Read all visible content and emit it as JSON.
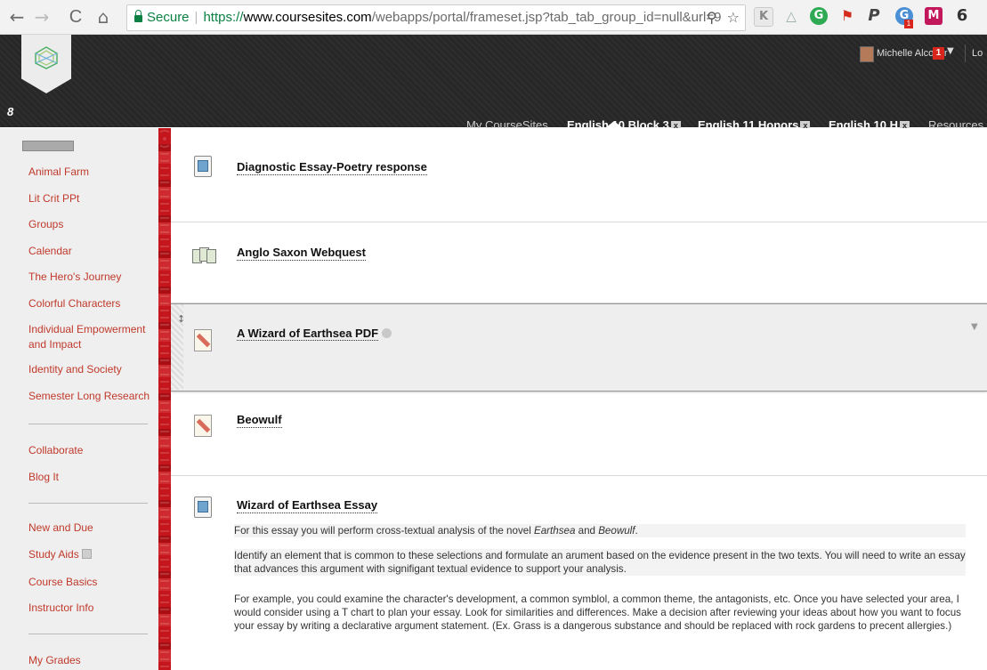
{
  "browser": {
    "back": "←",
    "forward": "→",
    "reload": "C",
    "home": "⌂",
    "secure_label": "Secure",
    "url_proto": "https://",
    "url_host": "www.coursesites.com",
    "url_path": "/webapps/portal/frameset.jsp?tab_tab_group_id=null&url=9",
    "zoom_icon": "zoom-icon",
    "star_icon": "star-icon",
    "extensions": [
      "K",
      "△",
      "G",
      "⚑",
      "P",
      "G",
      "M",
      "6"
    ],
    "ext_badge": "1"
  },
  "header": {
    "user_name": "Michelle Alcoser",
    "notif_count": "1",
    "logout": "Lo",
    "pin": "8",
    "tabs": [
      "My CourseSites",
      "English 10 Block 3",
      "English 11 Honors",
      "English 10 H",
      "Resources"
    ],
    "tab_close": "x"
  },
  "sidebar": {
    "items": [
      "Animal Farm",
      "Lit Crit PPt",
      "Groups",
      "Calendar",
      "The Hero's Journey",
      "Colorful Characters",
      "Individual Empowerment and Impact",
      "Identity and Society",
      "Semester Long Research",
      "Collaborate",
      "Blog It",
      "New and Due",
      "Study Aids",
      "Course Basics",
      "Instructor Info",
      "My Grades"
    ]
  },
  "content": {
    "items": [
      {
        "title": "Diagnostic Essay-Poetry response",
        "icon": "assignment-icon"
      },
      {
        "title": "Anglo Saxon Webquest",
        "icon": "webquest-icon"
      },
      {
        "title": "A Wizard of Earthsea PDF",
        "icon": "file-icon"
      },
      {
        "title": "Beowulf",
        "icon": "file-icon"
      },
      {
        "title": "Wizard of Earthsea Essay",
        "icon": "assignment-icon"
      }
    ],
    "essay_paragraphs": {
      "p1_prefix": "For this essay you will perform cross-textual analysis of the novel ",
      "p1_em1": "Earthsea",
      "p1_mid": " and ",
      "p1_em2": "Beowulf",
      "p1_suffix": ".",
      "p2": "Identify an element that is common to these selections and formulate an arument based on the evidence present in the two texts. You will need to write an essay that advances this argument with signifigant textual evidence to support your analysis.",
      "p3": "For example, you could examine the character's development, a common symblol, a common theme, the antagonists, etc. Once you have selected your area, I would consider using a T chart to plan your essay. Look for similarities and differences. Make a decision after reviewing your ideas about how you want to focus your essay by writing a declarative argument statement. (Ex. Grass is a dangerous substance and should be replaced with rock gardens to precent allergies.)"
    }
  }
}
